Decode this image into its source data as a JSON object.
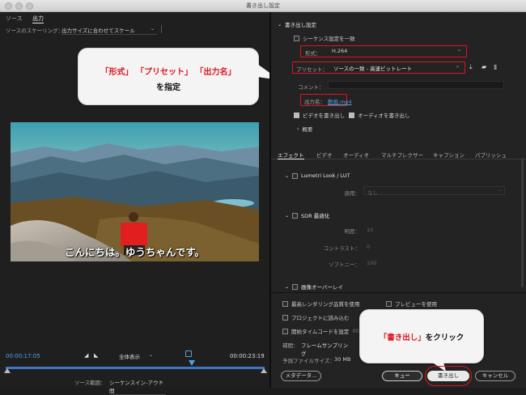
{
  "window": {
    "title": "書き出し設定"
  },
  "left": {
    "tabs": [
      "ソース",
      "出力"
    ],
    "scaling_label": "ソースのスケーリング：",
    "scaling_value": "出力サイズに合わせてスケール",
    "subtitle": "こんにちは。ゆうちゃんです。",
    "timecode_start": "00:00:17:05",
    "timecode_end": "00:00:23:19",
    "zoom_value": "全体表示",
    "source_range_label": "ソース範囲：",
    "source_range_value": "シーケンスイン-アウト間",
    "playhead_progress": 0.72
  },
  "callouts": {
    "format_bubble": {
      "parts": [
        "「形式」",
        "「プリセット」",
        "「出力名」"
      ],
      "line2": "を指定"
    },
    "export_bubble": {
      "highlight": "「書き出し」",
      "text": "をクリック"
    }
  },
  "export_settings": {
    "section_title": "書き出し設定",
    "match_sequence": "シーケンス設定を一致",
    "format_label": "形式：",
    "format_value": "H.264",
    "preset_label": "プリセット：",
    "preset_value": "ソースの一致 - 高速ビットレート",
    "comment_label": "コメント：",
    "output_name_label": "出力名：",
    "output_name_value": "動画.mp4",
    "export_video": "ビデオを書き出し",
    "export_audio": "オーディオを書き出し",
    "summary": "概要"
  },
  "effects_tabs": [
    "エフェクト",
    "ビデオ",
    "オーディオ",
    "マルチプレクサー",
    "キャプション",
    "パブリッシュ"
  ],
  "effects": {
    "lumetri": {
      "title": "Lumetri Look / LUT",
      "apply_label": "適用：",
      "apply_value": "なし"
    },
    "sdr": {
      "title": "SDR 最適化",
      "brightness_label": "明度：",
      "brightness_value": "10",
      "contrast_label": "コントラスト：",
      "contrast_value": "0",
      "softness_label": "ソフトニー：",
      "softness_value": "100"
    },
    "overlay": {
      "title": "画像オーバーレイ"
    }
  },
  "bottom": {
    "max_render": "最高レンダリング品質を使用",
    "use_previews": "プレビューを使用",
    "import_project": "プロジェクトに読み込む",
    "start_timecode": "開始タイムコードを設定",
    "start_timecode_value": "00:00:00:00",
    "interp_label": "補間：",
    "interp_value": "フレームサンプリング",
    "file_size_label": "予測ファイルサイズ：",
    "file_size_value": "30 MB",
    "metadata_btn": "メタデータ...",
    "queue_btn": "キュー",
    "export_btn": "書き出し",
    "cancel_btn": "キャンセル"
  }
}
